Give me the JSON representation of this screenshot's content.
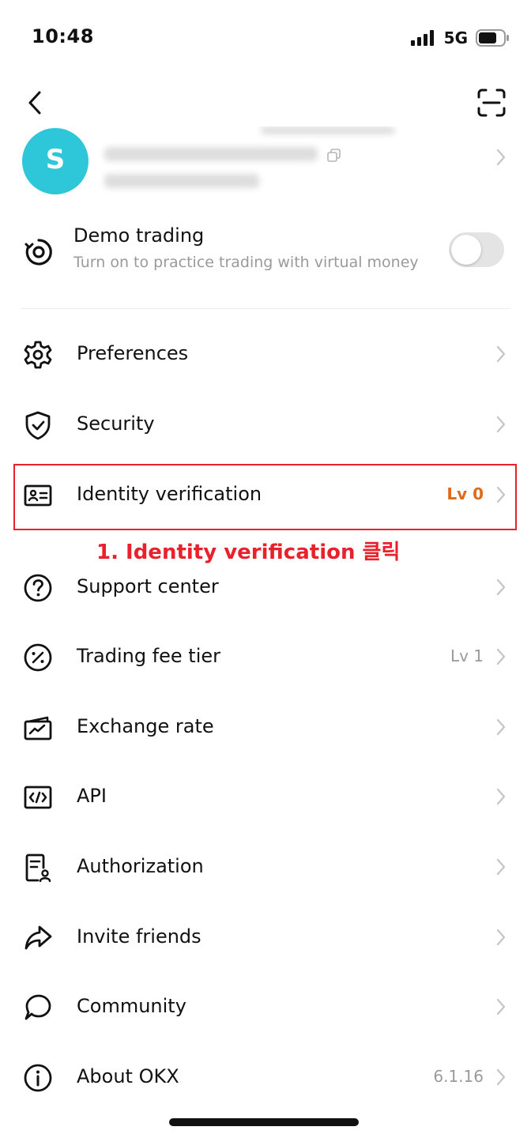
{
  "status_bar": {
    "time": "10:48",
    "network": "5G",
    "signal_icon": "signal-bars-icon",
    "battery_icon": "battery-icon"
  },
  "nav": {
    "back_icon": "chevron-left-icon",
    "scan_icon": "scan-icon"
  },
  "profile": {
    "avatar_letter": "S"
  },
  "demo_trading": {
    "title": "Demo trading",
    "subtitle": "Turn on to practice trading with virtual money",
    "enabled": false
  },
  "menu": [
    {
      "label": "Preferences",
      "value": "",
      "icon": "gear-icon"
    },
    {
      "label": "Security",
      "value": "",
      "icon": "shield-check-icon"
    },
    {
      "label": "Identity verification",
      "value": "Lv 0",
      "icon": "id-card-icon"
    },
    {
      "label": "Support center",
      "value": "",
      "icon": "question-circle-icon"
    },
    {
      "label": "Trading fee tier",
      "value": "Lv 1",
      "icon": "percent-circle-icon"
    },
    {
      "label": "Exchange rate",
      "value": "",
      "icon": "chart-card-icon"
    },
    {
      "label": "API",
      "value": "",
      "icon": "code-icon"
    },
    {
      "label": "Authorization",
      "value": "",
      "icon": "document-user-icon"
    },
    {
      "label": "Invite friends",
      "value": "",
      "icon": "share-arrow-icon"
    },
    {
      "label": "Community",
      "value": "",
      "icon": "chat-bubble-icon"
    },
    {
      "label": "About OKX",
      "value": "6.1.16",
      "icon": "info-circle-icon"
    }
  ],
  "annotation": {
    "text": "1. Identity verification 클릭"
  },
  "colors": {
    "avatar": "#2ec7d9",
    "level_highlight": "#e06a1b",
    "annotation_red": "#e8212b"
  }
}
